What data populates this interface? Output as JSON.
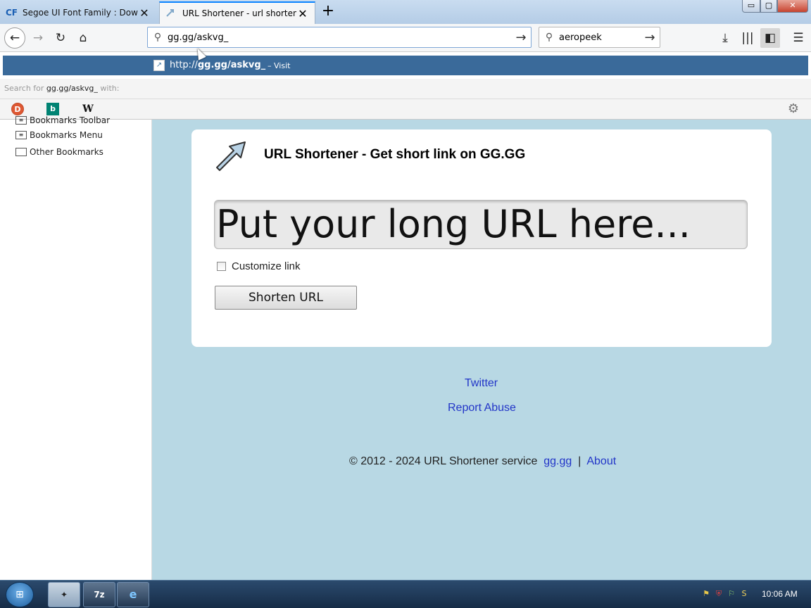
{
  "tabs": [
    {
      "favicon": "CF",
      "title": "Segoe UI Font Family : Downl",
      "active": false
    },
    {
      "favicon": "link-icon",
      "title": "URL Shortener - url shortening",
      "active": true
    }
  ],
  "window_controls": {
    "minimize": "▭",
    "maximize": "▢",
    "close": "✕"
  },
  "navbar": {
    "url_value": "gg.gg/askvg_",
    "search_value": "aeropeek"
  },
  "urlbar_popup": {
    "selected": {
      "prefix": "http://",
      "bold": "gg.gg/askvg_",
      "action": "– Visit"
    },
    "search_for_prefix": "Search for",
    "search_for_query": "gg.gg/askvg_",
    "search_for_suffix": "with:",
    "engines": [
      "DuckDuckGo",
      "Bing",
      "Wikipedia"
    ]
  },
  "sidebar": {
    "items": [
      {
        "label": "Bookmarks Toolbar"
      },
      {
        "label": "Bookmarks Menu"
      },
      {
        "label": "Other Bookmarks"
      }
    ]
  },
  "page": {
    "title": "URL Shortener - Get short link on GG.GG",
    "url_placeholder": "Put your long URL here...",
    "customize_label": "Customize link",
    "shorten_button": "Shorten URL",
    "twitter_link": "Twitter",
    "report_link": "Report Abuse",
    "footer_text": "© 2012 - 2024 URL Shortener service",
    "footer_link1": "gg.gg",
    "footer_sep": "|",
    "footer_link2": "About"
  },
  "taskbar": {
    "clock": "10:06 AM",
    "apps": [
      "firefox",
      "7z",
      "ie"
    ]
  },
  "colors": {
    "content_bg": "#b8d8e4",
    "popup_selected": "#3a6a9a",
    "link": "#2235c8"
  }
}
